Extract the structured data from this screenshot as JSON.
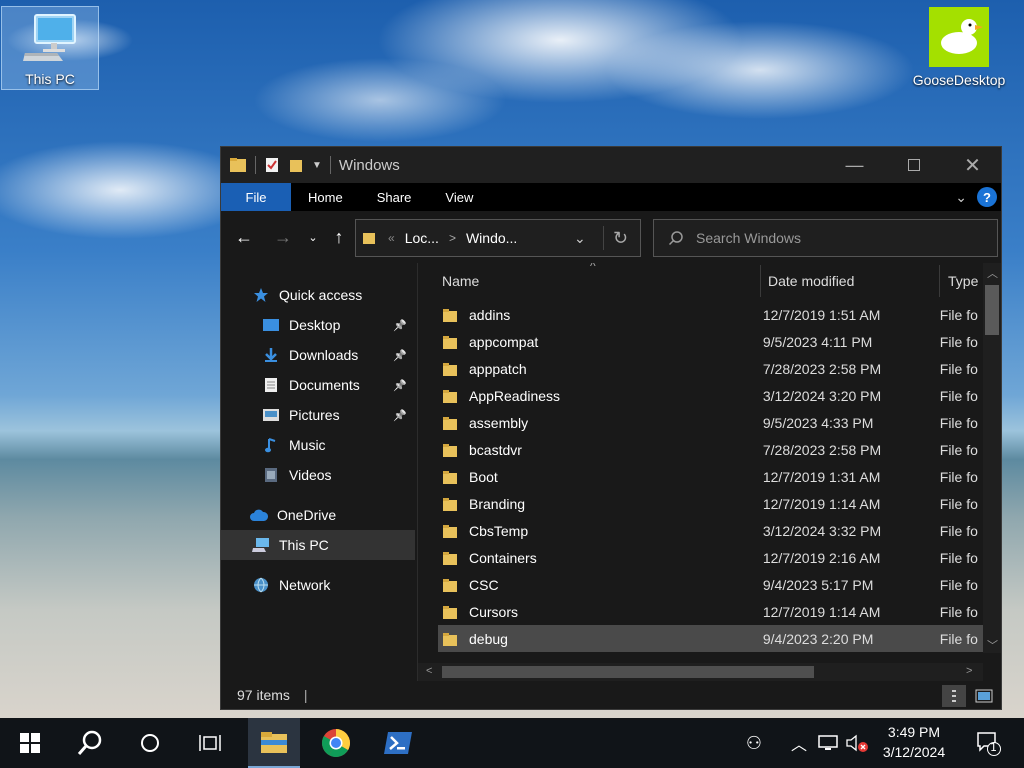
{
  "desktop": {
    "icons": [
      {
        "label": "This PC"
      },
      {
        "label": "GooseDesktop"
      }
    ]
  },
  "window": {
    "title": "Windows",
    "ribbon_tabs": [
      "File",
      "Home",
      "Share",
      "View"
    ],
    "help_label": "?",
    "address": {
      "overflow": "«",
      "segments": [
        "Loc...",
        "Windo..."
      ],
      "separator": ">"
    },
    "search": {
      "placeholder": "Search Windows"
    },
    "nav_pane": [
      {
        "label": "Quick access",
        "icon": "star-icon",
        "pinned": false
      },
      {
        "label": "Desktop",
        "icon": "desktop-folder-icon",
        "pinned": true
      },
      {
        "label": "Downloads",
        "icon": "download-icon",
        "pinned": true
      },
      {
        "label": "Documents",
        "icon": "document-icon",
        "pinned": true
      },
      {
        "label": "Pictures",
        "icon": "picture-icon",
        "pinned": true
      },
      {
        "label": "Music",
        "icon": "music-icon",
        "pinned": false
      },
      {
        "label": "Videos",
        "icon": "video-icon",
        "pinned": false
      },
      {
        "label": "OneDrive",
        "icon": "cloud-icon",
        "pinned": false
      },
      {
        "label": "This PC",
        "icon": "computer-icon",
        "pinned": false,
        "selected": true
      },
      {
        "label": "Network",
        "icon": "network-icon",
        "pinned": false
      }
    ],
    "columns": {
      "name": "Name",
      "date": "Date modified",
      "type": "Type"
    },
    "files": [
      {
        "name": "addins",
        "date": "12/7/2019 1:51 AM",
        "type": "File fo"
      },
      {
        "name": "appcompat",
        "date": "9/5/2023 4:11 PM",
        "type": "File fo"
      },
      {
        "name": "apppatch",
        "date": "7/28/2023 2:58 PM",
        "type": "File fo"
      },
      {
        "name": "AppReadiness",
        "date": "3/12/2024 3:20 PM",
        "type": "File fo"
      },
      {
        "name": "assembly",
        "date": "9/5/2023 4:33 PM",
        "type": "File fo"
      },
      {
        "name": "bcastdvr",
        "date": "7/28/2023 2:58 PM",
        "type": "File fo"
      },
      {
        "name": "Boot",
        "date": "12/7/2019 1:31 AM",
        "type": "File fo"
      },
      {
        "name": "Branding",
        "date": "12/7/2019 1:14 AM",
        "type": "File fo"
      },
      {
        "name": "CbsTemp",
        "date": "3/12/2024 3:32 PM",
        "type": "File fo"
      },
      {
        "name": "Containers",
        "date": "12/7/2019 2:16 AM",
        "type": "File fo"
      },
      {
        "name": "CSC",
        "date": "9/4/2023 5:17 PM",
        "type": "File fo"
      },
      {
        "name": "Cursors",
        "date": "12/7/2019 1:14 AM",
        "type": "File fo"
      },
      {
        "name": "debug",
        "date": "9/4/2023 2:20 PM",
        "type": "File fo",
        "hover": true
      }
    ],
    "status": {
      "count": "97 items"
    }
  },
  "taskbar": {
    "clock": {
      "time": "3:49 PM",
      "date": "3/12/2024"
    },
    "notification_count": "1"
  },
  "colors": {
    "accent": "#1a5fb4",
    "folder": "#e8c15a",
    "window_bg": "#191919"
  }
}
